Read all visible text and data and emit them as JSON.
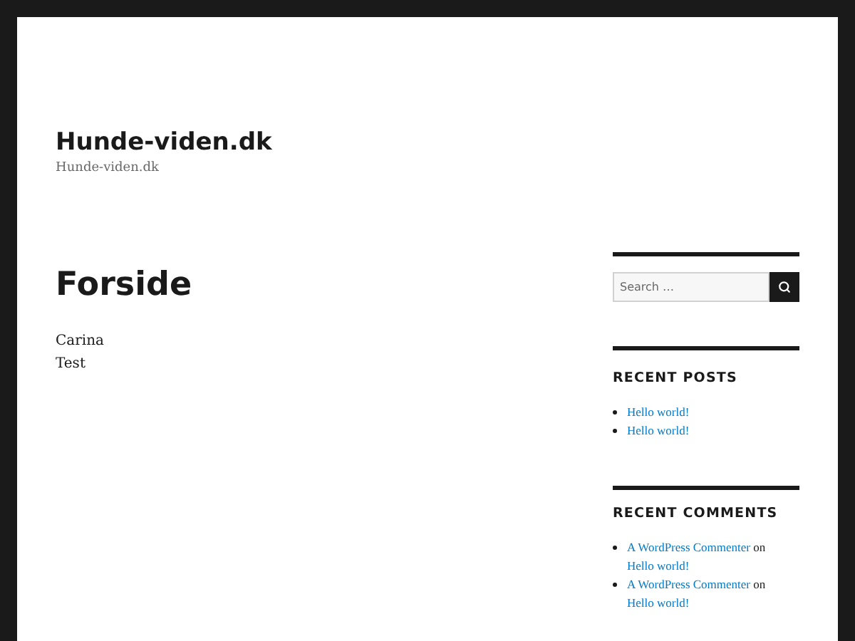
{
  "site": {
    "title": "Hunde-viden.dk",
    "tagline": "Hunde-viden.dk"
  },
  "page": {
    "title": "Forside",
    "lines": [
      "Carina",
      "Test"
    ]
  },
  "sidebar": {
    "search": {
      "placeholder": "Search …"
    },
    "recent_posts": {
      "heading": "RECENT POSTS",
      "items": [
        "Hello world!",
        "Hello world!"
      ]
    },
    "recent_comments": {
      "heading": "RECENT COMMENTS",
      "items": [
        {
          "author": "A WordPress Commenter",
          "on": "on",
          "post": "Hello world!"
        },
        {
          "author": "A WordPress Commenter",
          "on": "on",
          "post": "Hello world!"
        }
      ]
    }
  }
}
